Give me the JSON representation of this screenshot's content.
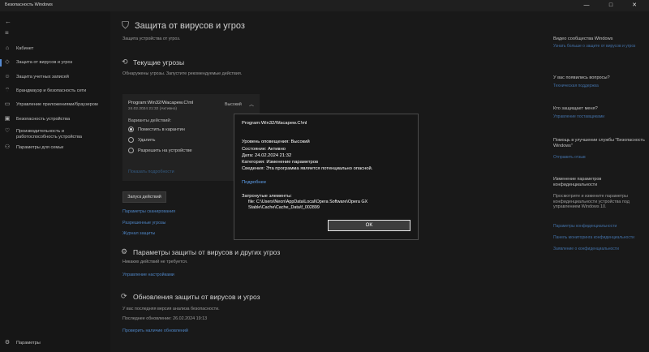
{
  "window": {
    "title": "Безопасность Windows",
    "controls": {
      "minimize": "—",
      "maximize": "□",
      "close": "✕"
    }
  },
  "sidebar": {
    "back_icon": "←",
    "menu_icon": "≡",
    "items": [
      {
        "label": "Кабинет",
        "icon": "⌂"
      },
      {
        "label": "Защита от вирусов и угроз",
        "icon": "◇"
      },
      {
        "label": "Защита учетных записей",
        "icon": "☺"
      },
      {
        "label": "Брандмауэр и безопасность сети",
        "icon": "⌔"
      },
      {
        "label": "Управление приложениями/браузером",
        "icon": "▭"
      },
      {
        "label": "Безопасность устройства",
        "icon": "▣"
      },
      {
        "label": "Производительность и работоспособность устройства",
        "icon": "♡"
      },
      {
        "label": "Параметры для семьи",
        "icon": "⚇"
      }
    ],
    "settings": {
      "label": "Параметры",
      "icon": "⚙"
    }
  },
  "main": {
    "title": "Защита от вирусов и угроз",
    "subtitle": "Защита устройства от угроз.",
    "current_threats": {
      "title": "Текущие угрозы",
      "subtitle": "Обнаружены угрозы. Запустите рекомендуемые действия.",
      "threat": {
        "name": "Program:Win32/Wacapew.C!ml",
        "date": "24.02.2024 21:32 (Активно)",
        "severity": "Высокий",
        "options_title": "Варианты действий:",
        "options": [
          "Поместить в карантин",
          "Удалить",
          "Разрешить на устройстве"
        ],
        "details_link": "Показать подробности"
      },
      "start_button": "Запуск действий",
      "links": [
        "Параметры сканирования",
        "Разрешенные угрозы",
        "Журнал защиты"
      ]
    },
    "settings_section": {
      "title": "Параметры защиты от вирусов и других угроз",
      "subtitle": "Никаких действий не требуется.",
      "link": "Управление настройками"
    },
    "updates_section": {
      "title": "Обновления защиты от вирусов и угроз",
      "line1": "У вас последняя версия анализа безопасности.",
      "line2": "Последнее обновление: 26.02.2024 19:13",
      "link": "Проверить наличие обновлений"
    }
  },
  "right": {
    "video": {
      "title": "Видео сообщества Windows",
      "link": "Узнать больше о защите от вирусов и угроз"
    },
    "questions": {
      "title": "У вас появились вопросы?",
      "link": "Техническая поддержка"
    },
    "who": {
      "title": "Кто защищает меня?",
      "link": "Управление поставщиками"
    },
    "improve": {
      "title": "Помощь в улучшении службы \"Безопасность Windows\"",
      "link": "Отправить отзыв"
    },
    "privacy": {
      "title": "Изменение параметров конфиденциальности",
      "text": "Просмотрите и измените параметры конфиденциальности устройства под управлением Windows 10.",
      "links": [
        "Параметры конфиденциальности",
        "Панель мониторинга конфиденциальности",
        "Заявление о конфиденциальности"
      ]
    }
  },
  "dialog": {
    "title": "Program:Win32/Wacapew.C!ml",
    "alert_level": "Уровень оповещения: Высокий",
    "status": "Состояние: Активно",
    "date": "Дата: 24.02.2024 21:32",
    "category": "Категория: Изменение параметров",
    "details": "Сведения: Эта программа является потенциально опасной.",
    "more_link": "Подробнее",
    "affected_title": "Затронутые элементы:",
    "affected_item": "file: C:\\Users\\Neon\\AppData\\Local\\Opera Software\\Opera GX Stable\\Cache\\Cache_Data\\f_002899",
    "ok_button": "OK"
  }
}
